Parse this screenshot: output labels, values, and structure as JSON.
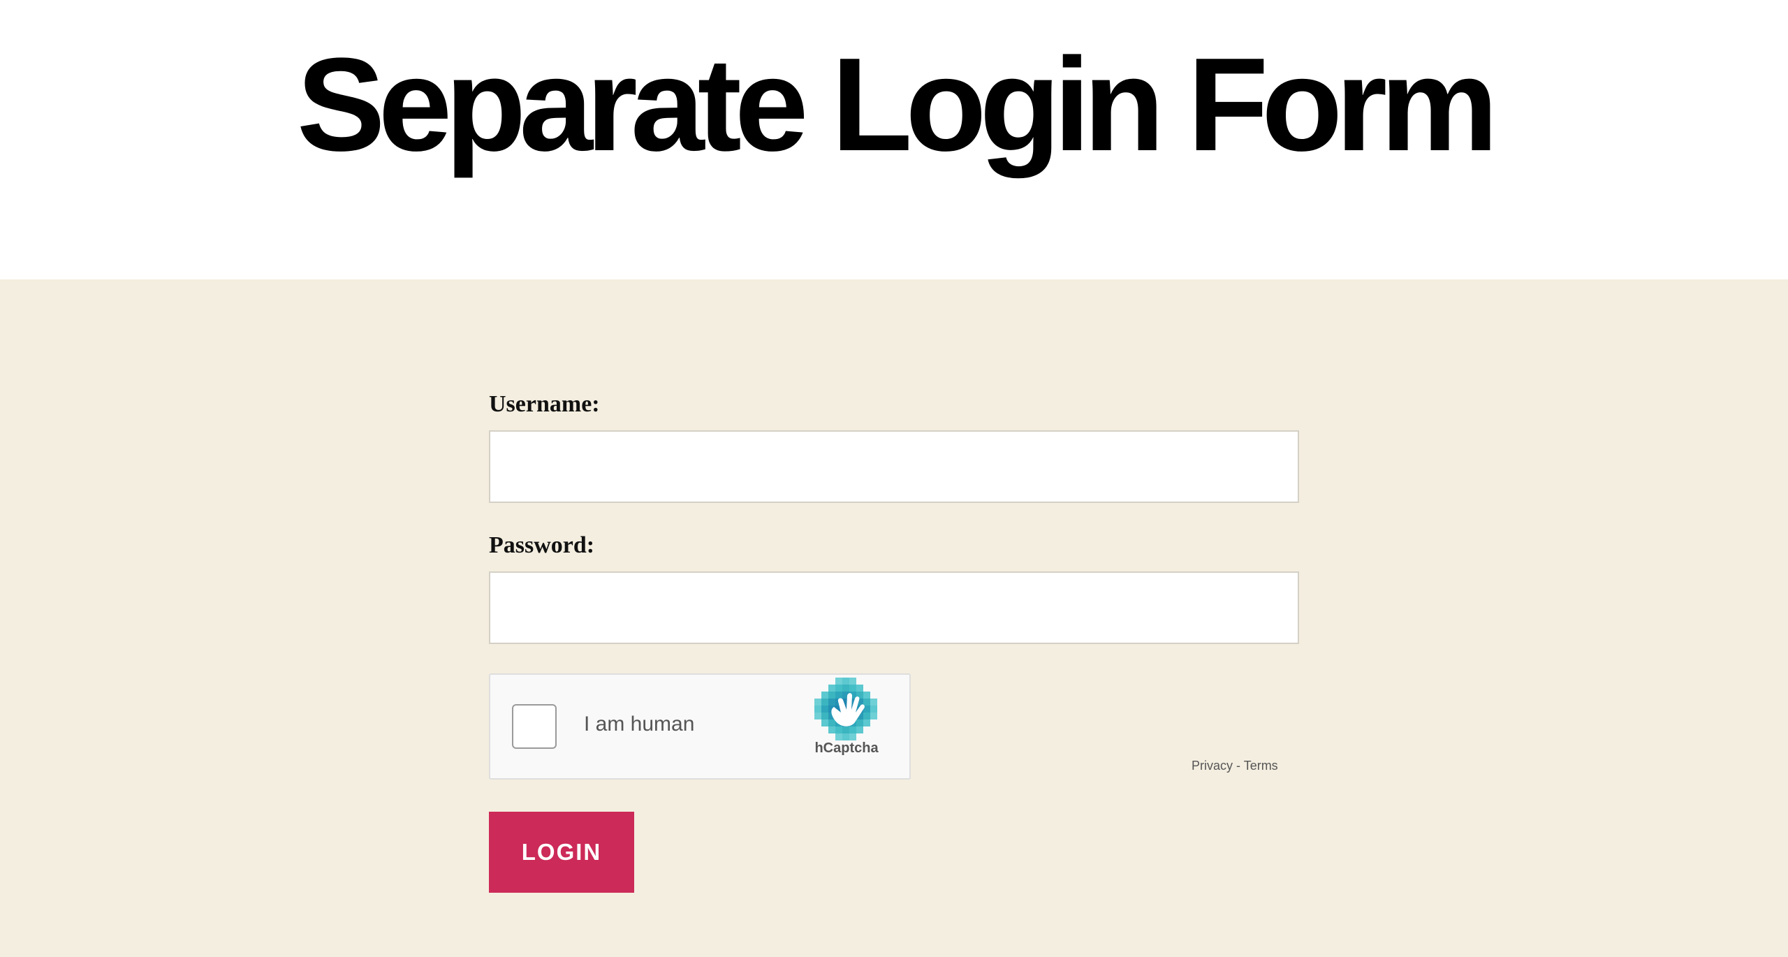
{
  "page": {
    "title": "Separate Login Form"
  },
  "form": {
    "username_label": "Username:",
    "username_value": "",
    "password_label": "Password:",
    "password_value": "",
    "login_label": "LOGIN"
  },
  "captcha": {
    "label": "I am human",
    "brand": "hCaptcha",
    "privacy": "Privacy",
    "separator": " - ",
    "terms": "Terms",
    "checked": false,
    "icon": "hcaptcha-logo-icon"
  },
  "colors": {
    "header_bg": "#ffffff",
    "main_bg": "#f4eee0",
    "button_bg": "#cc2a58",
    "button_text": "#ffffff",
    "title_text": "#000000"
  }
}
